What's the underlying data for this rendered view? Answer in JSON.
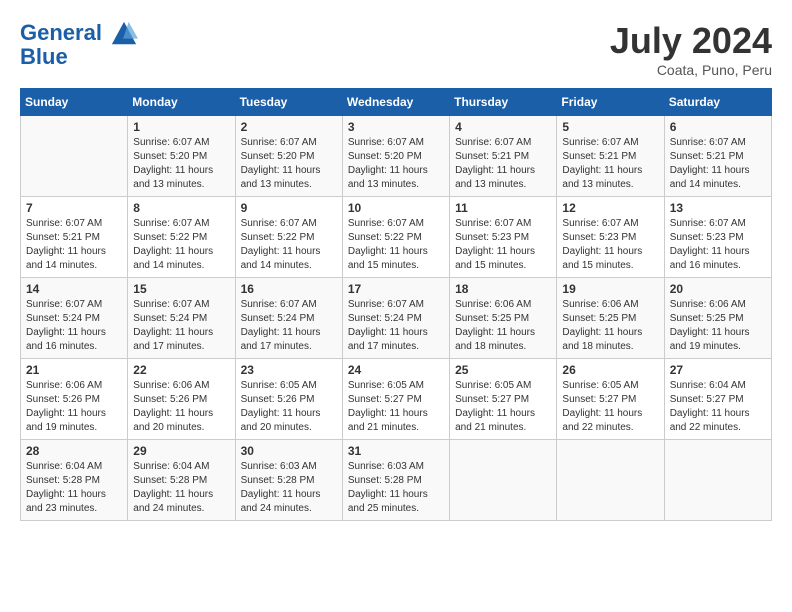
{
  "header": {
    "logo_line1": "General",
    "logo_line2": "Blue",
    "month": "July 2024",
    "location": "Coata, Puno, Peru"
  },
  "days_of_week": [
    "Sunday",
    "Monday",
    "Tuesday",
    "Wednesday",
    "Thursday",
    "Friday",
    "Saturday"
  ],
  "weeks": [
    [
      {
        "day": "",
        "sunrise": "",
        "sunset": "",
        "daylight": ""
      },
      {
        "day": "1",
        "sunrise": "Sunrise: 6:07 AM",
        "sunset": "Sunset: 5:20 PM",
        "daylight": "Daylight: 11 hours and 13 minutes."
      },
      {
        "day": "2",
        "sunrise": "Sunrise: 6:07 AM",
        "sunset": "Sunset: 5:20 PM",
        "daylight": "Daylight: 11 hours and 13 minutes."
      },
      {
        "day": "3",
        "sunrise": "Sunrise: 6:07 AM",
        "sunset": "Sunset: 5:20 PM",
        "daylight": "Daylight: 11 hours and 13 minutes."
      },
      {
        "day": "4",
        "sunrise": "Sunrise: 6:07 AM",
        "sunset": "Sunset: 5:21 PM",
        "daylight": "Daylight: 11 hours and 13 minutes."
      },
      {
        "day": "5",
        "sunrise": "Sunrise: 6:07 AM",
        "sunset": "Sunset: 5:21 PM",
        "daylight": "Daylight: 11 hours and 13 minutes."
      },
      {
        "day": "6",
        "sunrise": "Sunrise: 6:07 AM",
        "sunset": "Sunset: 5:21 PM",
        "daylight": "Daylight: 11 hours and 14 minutes."
      }
    ],
    [
      {
        "day": "7",
        "sunrise": "Sunrise: 6:07 AM",
        "sunset": "Sunset: 5:21 PM",
        "daylight": "Daylight: 11 hours and 14 minutes."
      },
      {
        "day": "8",
        "sunrise": "Sunrise: 6:07 AM",
        "sunset": "Sunset: 5:22 PM",
        "daylight": "Daylight: 11 hours and 14 minutes."
      },
      {
        "day": "9",
        "sunrise": "Sunrise: 6:07 AM",
        "sunset": "Sunset: 5:22 PM",
        "daylight": "Daylight: 11 hours and 14 minutes."
      },
      {
        "day": "10",
        "sunrise": "Sunrise: 6:07 AM",
        "sunset": "Sunset: 5:22 PM",
        "daylight": "Daylight: 11 hours and 15 minutes."
      },
      {
        "day": "11",
        "sunrise": "Sunrise: 6:07 AM",
        "sunset": "Sunset: 5:23 PM",
        "daylight": "Daylight: 11 hours and 15 minutes."
      },
      {
        "day": "12",
        "sunrise": "Sunrise: 6:07 AM",
        "sunset": "Sunset: 5:23 PM",
        "daylight": "Daylight: 11 hours and 15 minutes."
      },
      {
        "day": "13",
        "sunrise": "Sunrise: 6:07 AM",
        "sunset": "Sunset: 5:23 PM",
        "daylight": "Daylight: 11 hours and 16 minutes."
      }
    ],
    [
      {
        "day": "14",
        "sunrise": "Sunrise: 6:07 AM",
        "sunset": "Sunset: 5:24 PM",
        "daylight": "Daylight: 11 hours and 16 minutes."
      },
      {
        "day": "15",
        "sunrise": "Sunrise: 6:07 AM",
        "sunset": "Sunset: 5:24 PM",
        "daylight": "Daylight: 11 hours and 17 minutes."
      },
      {
        "day": "16",
        "sunrise": "Sunrise: 6:07 AM",
        "sunset": "Sunset: 5:24 PM",
        "daylight": "Daylight: 11 hours and 17 minutes."
      },
      {
        "day": "17",
        "sunrise": "Sunrise: 6:07 AM",
        "sunset": "Sunset: 5:24 PM",
        "daylight": "Daylight: 11 hours and 17 minutes."
      },
      {
        "day": "18",
        "sunrise": "Sunrise: 6:06 AM",
        "sunset": "Sunset: 5:25 PM",
        "daylight": "Daylight: 11 hours and 18 minutes."
      },
      {
        "day": "19",
        "sunrise": "Sunrise: 6:06 AM",
        "sunset": "Sunset: 5:25 PM",
        "daylight": "Daylight: 11 hours and 18 minutes."
      },
      {
        "day": "20",
        "sunrise": "Sunrise: 6:06 AM",
        "sunset": "Sunset: 5:25 PM",
        "daylight": "Daylight: 11 hours and 19 minutes."
      }
    ],
    [
      {
        "day": "21",
        "sunrise": "Sunrise: 6:06 AM",
        "sunset": "Sunset: 5:26 PM",
        "daylight": "Daylight: 11 hours and 19 minutes."
      },
      {
        "day": "22",
        "sunrise": "Sunrise: 6:06 AM",
        "sunset": "Sunset: 5:26 PM",
        "daylight": "Daylight: 11 hours and 20 minutes."
      },
      {
        "day": "23",
        "sunrise": "Sunrise: 6:05 AM",
        "sunset": "Sunset: 5:26 PM",
        "daylight": "Daylight: 11 hours and 20 minutes."
      },
      {
        "day": "24",
        "sunrise": "Sunrise: 6:05 AM",
        "sunset": "Sunset: 5:27 PM",
        "daylight": "Daylight: 11 hours and 21 minutes."
      },
      {
        "day": "25",
        "sunrise": "Sunrise: 6:05 AM",
        "sunset": "Sunset: 5:27 PM",
        "daylight": "Daylight: 11 hours and 21 minutes."
      },
      {
        "day": "26",
        "sunrise": "Sunrise: 6:05 AM",
        "sunset": "Sunset: 5:27 PM",
        "daylight": "Daylight: 11 hours and 22 minutes."
      },
      {
        "day": "27",
        "sunrise": "Sunrise: 6:04 AM",
        "sunset": "Sunset: 5:27 PM",
        "daylight": "Daylight: 11 hours and 22 minutes."
      }
    ],
    [
      {
        "day": "28",
        "sunrise": "Sunrise: 6:04 AM",
        "sunset": "Sunset: 5:28 PM",
        "daylight": "Daylight: 11 hours and 23 minutes."
      },
      {
        "day": "29",
        "sunrise": "Sunrise: 6:04 AM",
        "sunset": "Sunset: 5:28 PM",
        "daylight": "Daylight: 11 hours and 24 minutes."
      },
      {
        "day": "30",
        "sunrise": "Sunrise: 6:03 AM",
        "sunset": "Sunset: 5:28 PM",
        "daylight": "Daylight: 11 hours and 24 minutes."
      },
      {
        "day": "31",
        "sunrise": "Sunrise: 6:03 AM",
        "sunset": "Sunset: 5:28 PM",
        "daylight": "Daylight: 11 hours and 25 minutes."
      },
      {
        "day": "",
        "sunrise": "",
        "sunset": "",
        "daylight": ""
      },
      {
        "day": "",
        "sunrise": "",
        "sunset": "",
        "daylight": ""
      },
      {
        "day": "",
        "sunrise": "",
        "sunset": "",
        "daylight": ""
      }
    ]
  ]
}
